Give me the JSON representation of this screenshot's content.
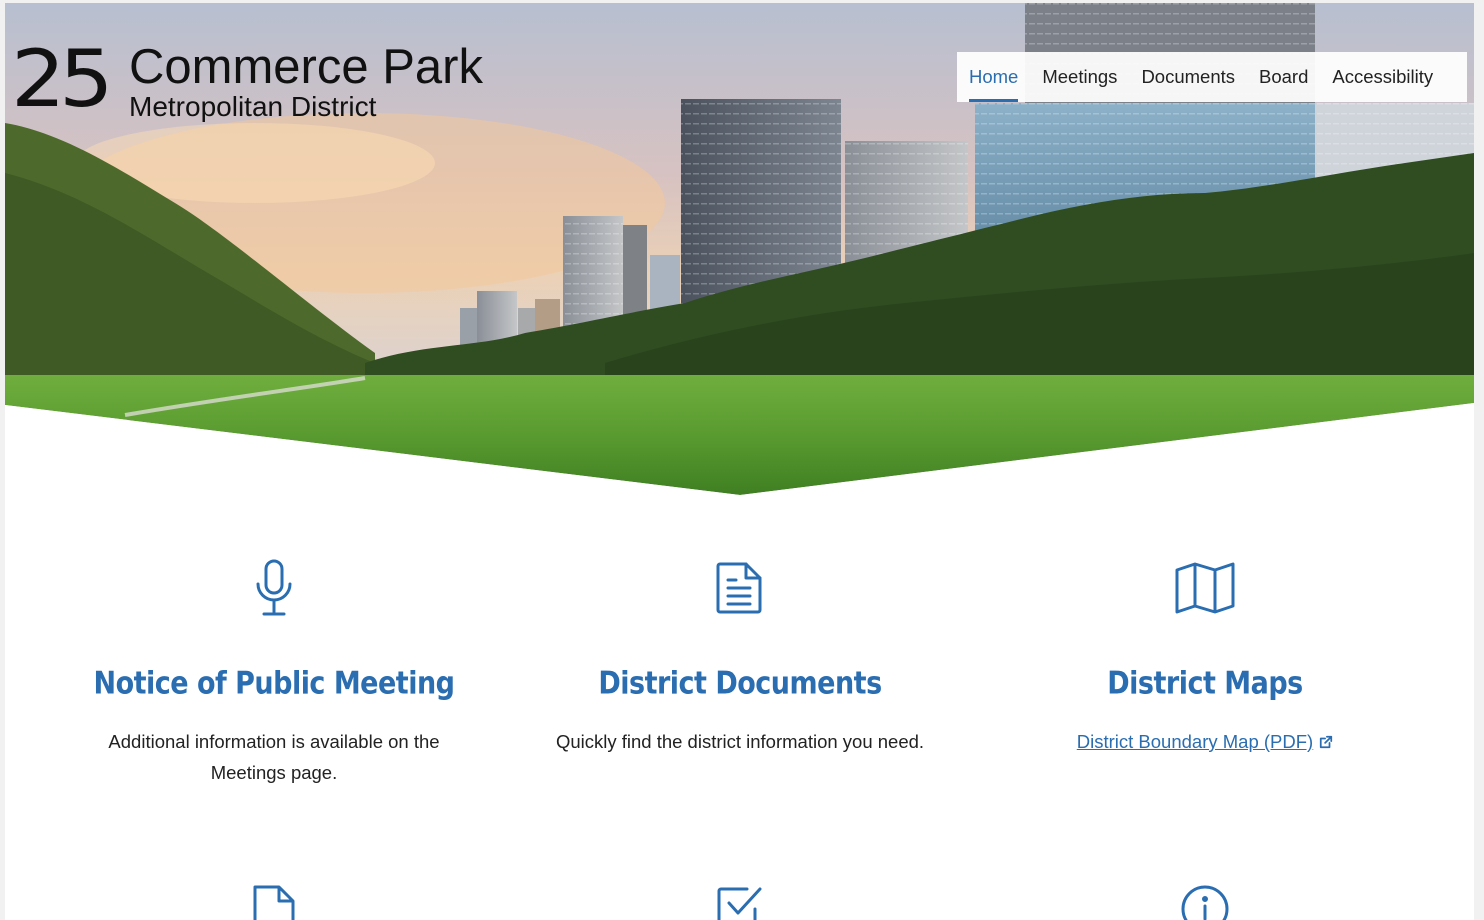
{
  "logo": {
    "number": "25",
    "name": "Commerce Park",
    "subtitle": "Metropolitan District"
  },
  "nav": {
    "items": [
      {
        "label": "Home",
        "active": true
      },
      {
        "label": "Meetings",
        "active": false
      },
      {
        "label": "Documents",
        "active": false
      },
      {
        "label": "Board",
        "active": false
      },
      {
        "label": "Accessibility",
        "active": false
      }
    ]
  },
  "cards": [
    {
      "icon": "microphone-icon",
      "title": "Notice of Public Meeting",
      "text": "Additional information is available on the Meetings page."
    },
    {
      "icon": "document-icon",
      "title": "District Documents",
      "text": "Quickly find the district information you need."
    },
    {
      "icon": "map-icon",
      "title": "District Maps",
      "link": "District Boundary Map (PDF)",
      "link_icon": "external-link-icon"
    }
  ],
  "row2_icons": [
    "file-icon",
    "checkbox-icon",
    "info-icon"
  ],
  "colors": {
    "accent": "#2a6db0",
    "text": "#222222",
    "background": "#ffffff"
  }
}
